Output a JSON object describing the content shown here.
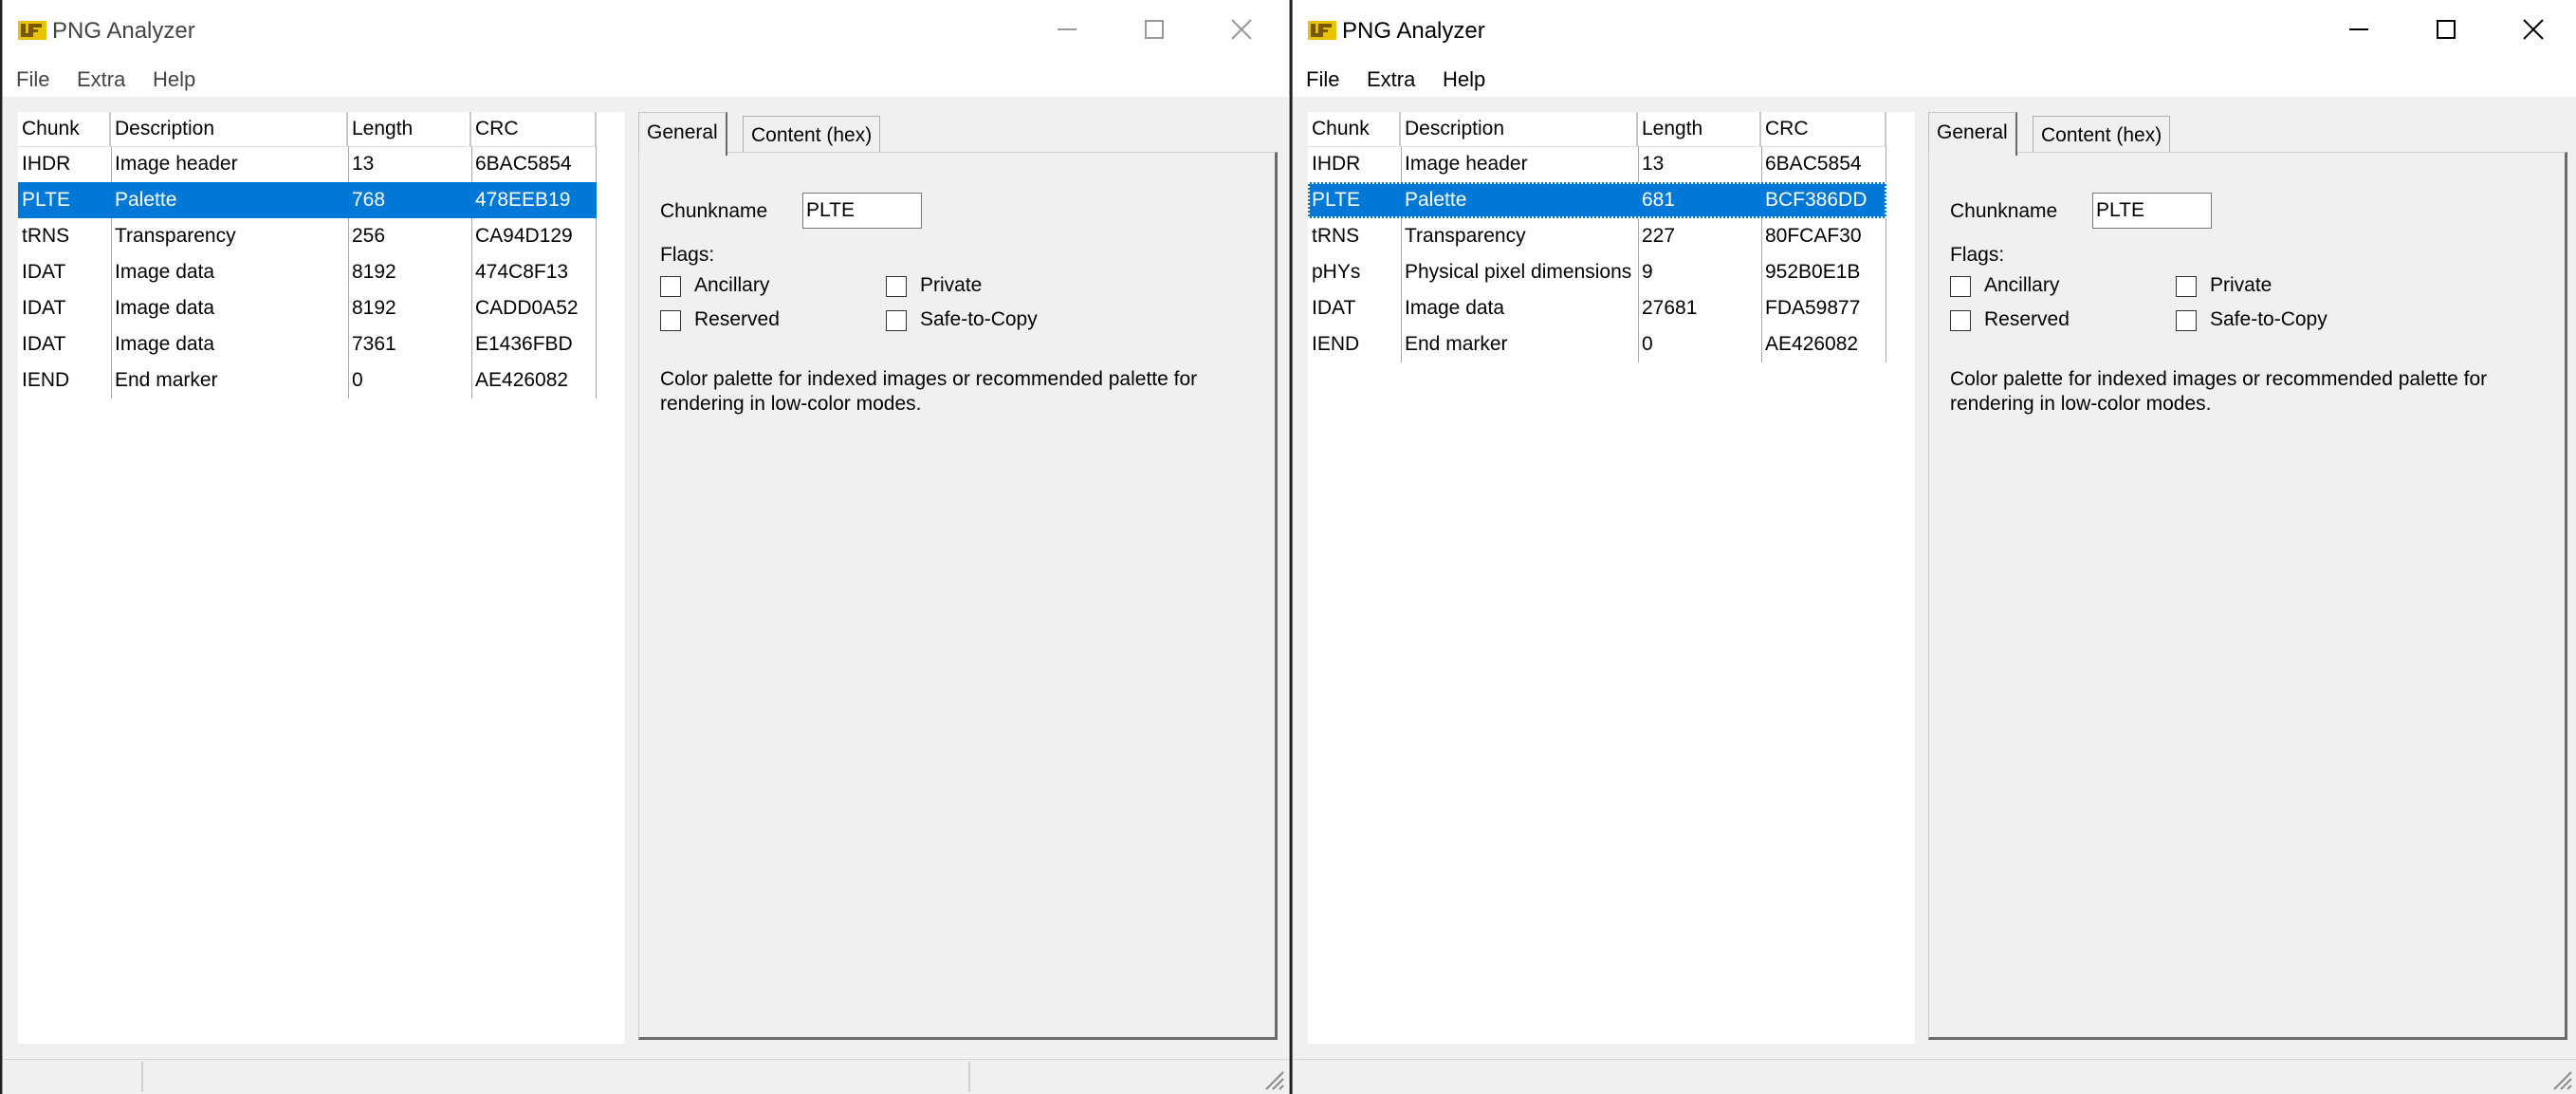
{
  "windows": [
    {
      "title": "PNG Analyzer",
      "menu": [
        "File",
        "Extra",
        "Help"
      ],
      "columns": [
        "Chunk",
        "Description",
        "Length",
        "CRC"
      ],
      "rows": [
        {
          "chunk": "IHDR",
          "description": "Image header",
          "length": "13",
          "crc": "6BAC5854"
        },
        {
          "chunk": "PLTE",
          "description": "Palette",
          "length": "768",
          "crc": "478EEB19"
        },
        {
          "chunk": "tRNS",
          "description": "Transparency",
          "length": "256",
          "crc": "CA94D129"
        },
        {
          "chunk": "IDAT",
          "description": "Image data",
          "length": "8192",
          "crc": "474C8F13"
        },
        {
          "chunk": "IDAT",
          "description": "Image data",
          "length": "8192",
          "crc": "CADD0A52"
        },
        {
          "chunk": "IDAT",
          "description": "Image data",
          "length": "7361",
          "crc": "E1436FBD"
        },
        {
          "chunk": "IEND",
          "description": "End marker",
          "length": "0",
          "crc": "AE426082"
        }
      ],
      "selected_row": 1,
      "tabs": [
        "General",
        "Content (hex)"
      ],
      "general": {
        "chunkname_label": "Chunkname",
        "chunkname_value": "PLTE",
        "flags_label": "Flags:",
        "flag_labels": {
          "ancillary": "Ancillary",
          "private": "Private",
          "reserved": "Reserved",
          "safe": "Safe-to-Copy"
        },
        "description": "Color palette for indexed images or recommended palette for rendering in low-color modes."
      }
    },
    {
      "title": "PNG Analyzer",
      "menu": [
        "File",
        "Extra",
        "Help"
      ],
      "columns": [
        "Chunk",
        "Description",
        "Length",
        "CRC"
      ],
      "rows": [
        {
          "chunk": "IHDR",
          "description": "Image header",
          "length": "13",
          "crc": "6BAC5854"
        },
        {
          "chunk": "PLTE",
          "description": "Palette",
          "length": "681",
          "crc": "BCF386DD"
        },
        {
          "chunk": "tRNS",
          "description": "Transparency",
          "length": "227",
          "crc": "80FCAF30"
        },
        {
          "chunk": "pHYs",
          "description": "Physical pixel dimensions",
          "length": "9",
          "crc": "952B0E1B"
        },
        {
          "chunk": "IDAT",
          "description": "Image data",
          "length": "27681",
          "crc": "FDA59877"
        },
        {
          "chunk": "IEND",
          "description": "End marker",
          "length": "0",
          "crc": "AE426082"
        }
      ],
      "selected_row": 1,
      "tabs": [
        "General",
        "Content (hex)"
      ],
      "general": {
        "chunkname_label": "Chunkname",
        "chunkname_value": "PLTE",
        "flags_label": "Flags:",
        "flag_labels": {
          "ancillary": "Ancillary",
          "private": "Private",
          "reserved": "Reserved",
          "safe": "Safe-to-Copy"
        },
        "description": "Color palette for indexed images or recommended palette for rendering in low-color modes."
      }
    }
  ],
  "colors": {
    "selection": "#0078d7",
    "background": "#f0f0f0",
    "titlebar": "#ffffff"
  },
  "icons": [
    "app-logo-icon",
    "minimize-icon",
    "maximize-icon",
    "close-icon",
    "resize-grip-icon"
  ]
}
